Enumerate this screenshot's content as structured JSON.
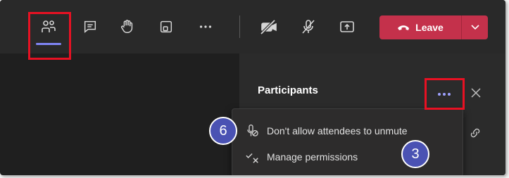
{
  "toolbar": {
    "buttons": [
      {
        "icon": "people-icon",
        "active": true
      },
      {
        "icon": "chat-icon"
      },
      {
        "icon": "raise-hand-icon"
      },
      {
        "icon": "rooms-icon"
      },
      {
        "icon": "more-actions-icon"
      },
      {
        "icon": "camera-off-icon"
      },
      {
        "icon": "mic-off-icon"
      },
      {
        "icon": "share-screen-icon"
      }
    ],
    "leave": {
      "label": "Leave",
      "icon": "phone-hangup-icon",
      "color": "#c4314b"
    }
  },
  "panel": {
    "title": "Participants"
  },
  "menu": {
    "items": [
      {
        "label": "Don't allow attendees to unmute",
        "icon": "mic-blocked-icon"
      },
      {
        "label": "Manage permissions",
        "icon": "permissions-icon"
      }
    ]
  },
  "annotations": {
    "badge_a": "6",
    "badge_b": "3",
    "highlight_color": "#e81123",
    "badge_color": "#4a52b3"
  },
  "colors": {
    "accent": "#7f85f5",
    "toolbar_bg": "#292929",
    "panel_bg": "#2b2b2b"
  }
}
